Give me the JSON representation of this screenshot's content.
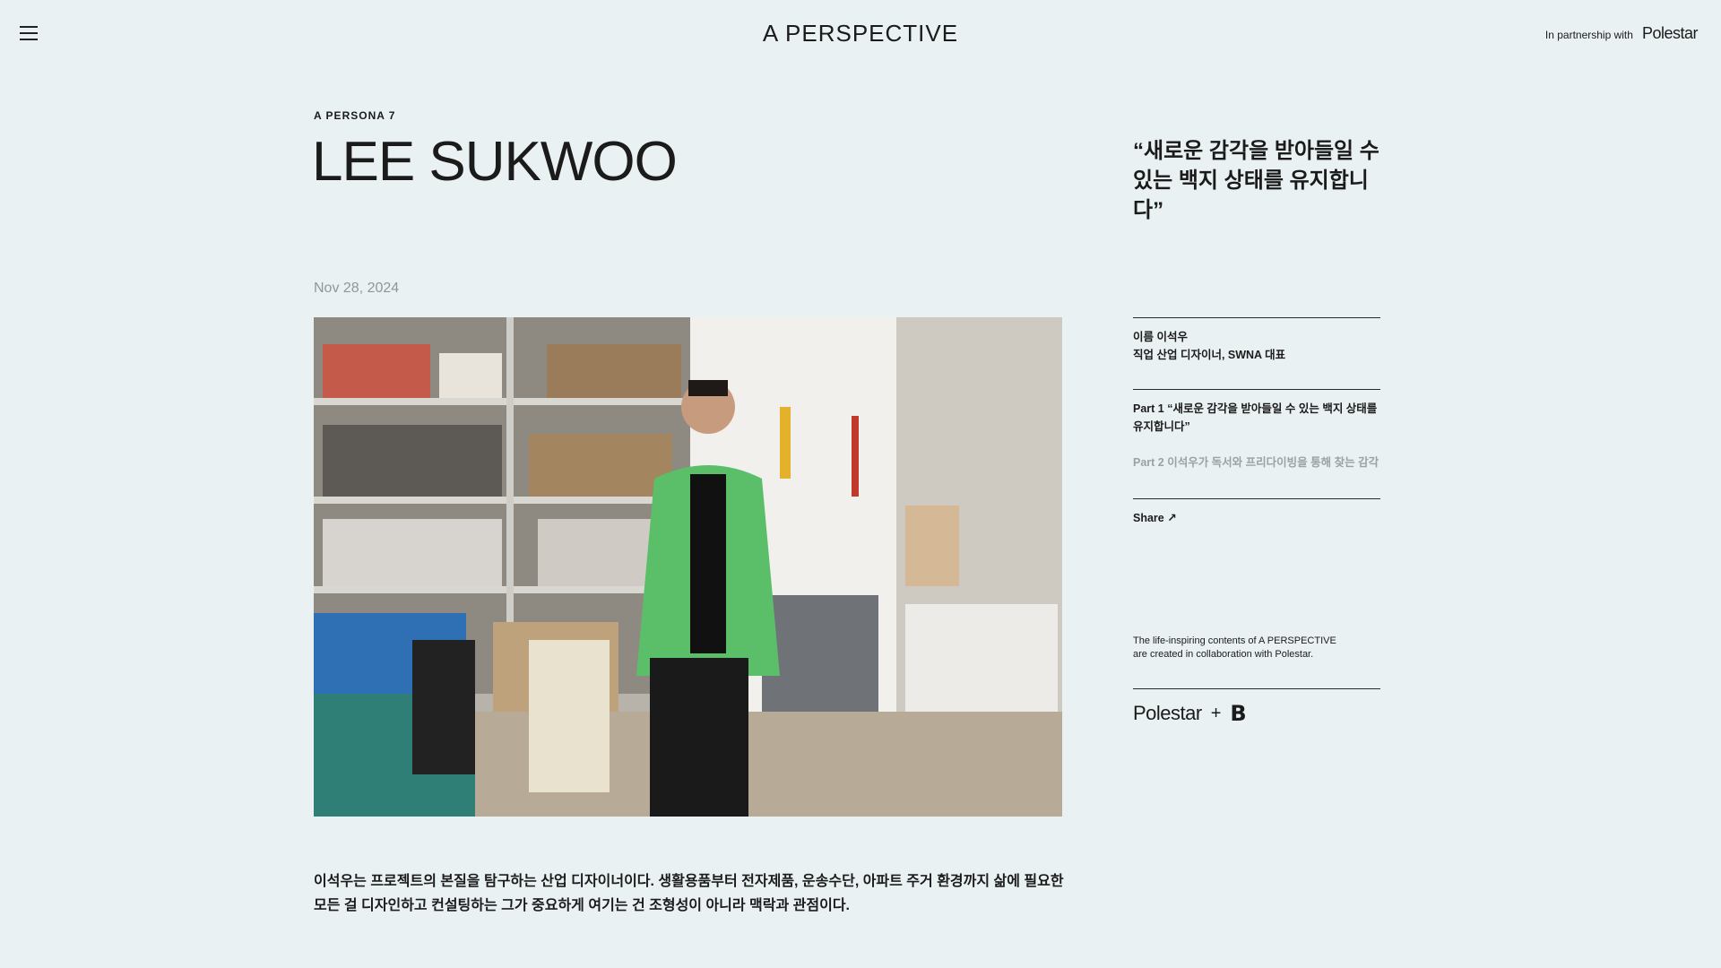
{
  "header": {
    "brand": "A  PERSPECTIVE",
    "partner_label": "In partnership with",
    "partner_logo": "Polestar"
  },
  "article": {
    "kicker": "A  PERSONA  7",
    "title": "LEE SUKWOO",
    "date": "Nov 28, 2024",
    "lead": "이석우는 프로젝트의 본질을 탐구하는 산업 디자이너이다. 생활용품부터 전자제품, 운송수단, 아파트 주거 환경까지 삶에 필요한 모든 걸 디자인하고 컨설팅하는 그가 중요하게 여기는 건 조형성이 아니라 맥락과 관점이다."
  },
  "sidebar": {
    "quote": "“새로운 감각을 받아들일 수 있는 백지 상태를 유지합니다”",
    "info": {
      "name": "이름 이석우",
      "job": "직업 산업 디자이너, SWNA 대표"
    },
    "parts": [
      {
        "label": "Part 1 “새로운 감각을 받아들일 수 있는 백지 상태를 유지합니다”"
      },
      {
        "label": "Part 2 이석우가 독서와 프리다이빙을 통해 찾는 감각"
      }
    ],
    "share_label": "Share ↗",
    "collab_text": "The life-inspiring contents of A PERSPECTIVE are created in collaboration with Polestar.",
    "logos": {
      "polestar": "Polestar",
      "plus": "+",
      "b": "B"
    }
  },
  "icons": {
    "menu": "hamburger-menu-icon"
  },
  "colors": {
    "background": "#eaf1f3",
    "text": "#1b1b1b",
    "muted": "#9aa2a6",
    "date": "#8e979b",
    "cardigan": "#5bbf6a"
  }
}
